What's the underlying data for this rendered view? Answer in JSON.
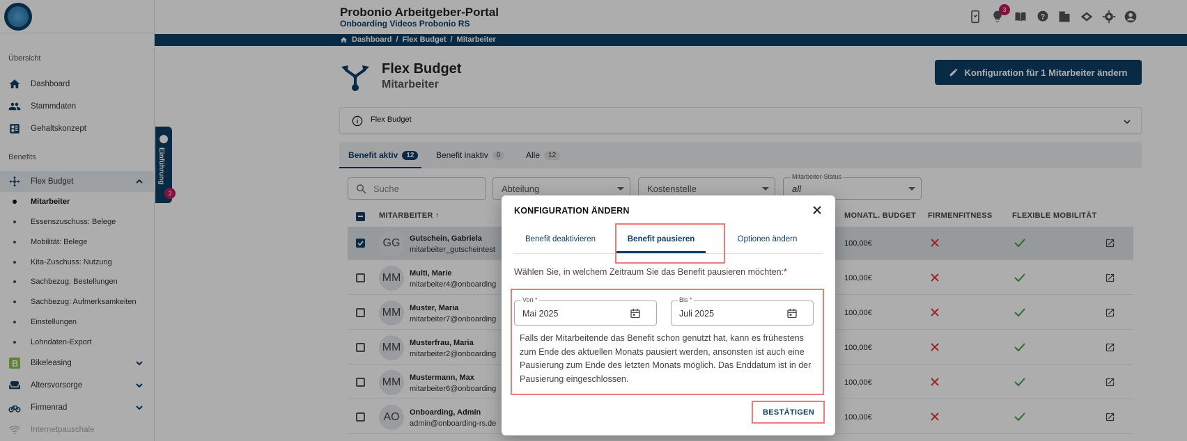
{
  "app": {
    "title": "Probonio Arbeitgeber-Portal",
    "subtitle": "Onboarding Videos Probonio RS",
    "notification_count": "3"
  },
  "breadcrumb": [
    "Dashboard",
    "/",
    "Flex Budget",
    "/",
    "Mitarbeiter"
  ],
  "sidebar": {
    "section_overview": "Übersicht",
    "overview_items": [
      {
        "label": "Dashboard",
        "icon": "home-icon"
      },
      {
        "label": "Stammdaten",
        "icon": "people-icon"
      },
      {
        "label": "Gehaltskonzept",
        "icon": "dashboard-grid-icon"
      }
    ],
    "section_benefits": "Benefits",
    "flex_budget": {
      "label": "Flex Budget",
      "icon": "arrows-split-icon"
    },
    "flex_sub_items": [
      "Mitarbeiter",
      "Essenszuschuss: Belege",
      "Mobilität: Belege",
      "Kita-Zuschuss: Nutzung",
      "Sachbezug: Bestellungen",
      "Sachbezug: Aufmerksamkeiten",
      "Einstellungen",
      "Lohndaten-Export"
    ],
    "other_benefits": [
      {
        "label": "Bikeleasing",
        "icon": "bikeleasing-icon"
      },
      {
        "label": "Altersvorsorge",
        "icon": "sofa-icon"
      },
      {
        "label": "Firmenrad",
        "icon": "bike-icon"
      },
      {
        "label": "Internetpauschale",
        "icon": "wifi-icon"
      }
    ],
    "intro_tab": "Einführung",
    "intro_badge": "3"
  },
  "page": {
    "title": "Flex Budget",
    "subtitle": "Mitarbeiter",
    "config_button": "Konfiguration für 1 Mitarbeiter ändern",
    "info_panel": "Flex Budget"
  },
  "tabs": [
    {
      "label": "Benefit aktiv",
      "count": "12"
    },
    {
      "label": "Benefit inaktiv",
      "count": "0"
    },
    {
      "label": "Alle",
      "count": "12"
    }
  ],
  "filters": {
    "search_placeholder": "Suche",
    "department": "Abteilung",
    "cost_center": "Kostenstelle",
    "status_label": "Mitarbeiter-Status",
    "status_value": "all"
  },
  "table": {
    "headers": [
      "MITARBEITER",
      "MONATL. BUDGET",
      "FIRMENFITNESS",
      "FLEXIBLE MOBILITÄT"
    ],
    "rows": [
      {
        "initials": "GG",
        "name": "Gutschein, Gabriela",
        "email": "mitarbeiter_gutscheintest",
        "budget": "100,00€",
        "selected": true
      },
      {
        "initials": "MM",
        "name": "Multi, Marie",
        "email": "mitarbeiter4@onboarding",
        "budget": "100,00€",
        "selected": false
      },
      {
        "initials": "MM",
        "name": "Muster, Maria",
        "email": "mitarbeiter7@onboarding",
        "budget": "100,00€",
        "selected": false
      },
      {
        "initials": "MM",
        "name": "Musterfrau, Maria",
        "email": "mitarbeiter2@onboarding",
        "budget": "100,00€",
        "selected": false
      },
      {
        "initials": "MM",
        "name": "Mustermann, Max",
        "email": "mitarbeiter6@onboarding",
        "budget": "100,00€",
        "selected": false
      },
      {
        "initials": "AO",
        "name": "Onboarding, Admin",
        "email": "admin@onboarding-rs.de",
        "budget": "100,00€",
        "selected": false
      }
    ]
  },
  "dialog": {
    "title": "KONFIGURATION ÄNDERN",
    "tabs": [
      "Benefit deaktivieren",
      "Benefit pausieren",
      "Optionen ändern"
    ],
    "question": "Wählen Sie, in welchem Zeitraum Sie das Benefit pausieren möchten:*",
    "from_label": "Von *",
    "from_value": "Mai 2025",
    "to_label": "Bis *",
    "to_value": "Juli 2025",
    "note": "Falls der Mitarbeitende das Benefit schon genutzt hat, kann es frühestens zum Ende des aktuellen Monats pausiert werden, ansonsten ist auch eine Pausierung zum Ende des letzten Monats möglich. Das Enddatum ist in der Pausierung eingeschlossen.",
    "confirm": "BESTÄTIGEN"
  },
  "colors": {
    "primary": "#0e3f66",
    "badge": "#c2185b",
    "highlight": "#ef7a7a",
    "cross": "#e53935",
    "check": "#43a047"
  }
}
